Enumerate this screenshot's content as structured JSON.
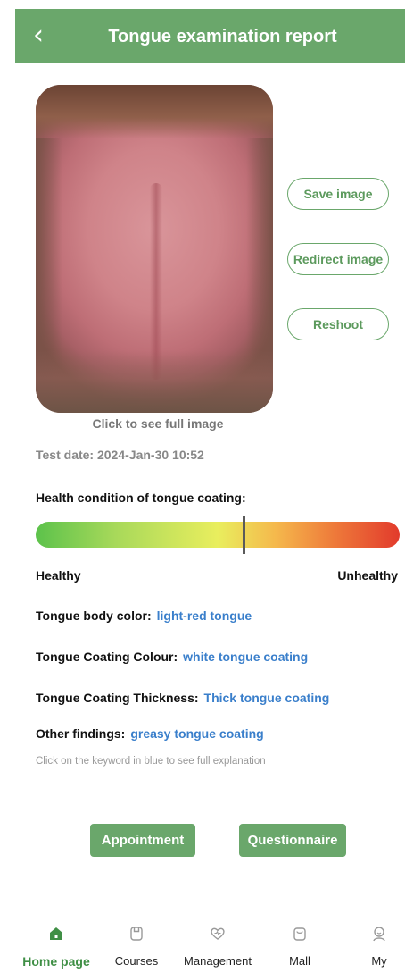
{
  "header": {
    "title": "Tongue examination report",
    "back_icon": "chevron-left-icon"
  },
  "photo": {
    "caption": "Click to see full image"
  },
  "actions_side": {
    "save": "Save image",
    "redirect": "Redirect image",
    "reshoot": "Reshoot"
  },
  "test_date": "Test date: 2024-Jan-30 10:52",
  "coating_health": {
    "label": "Health condition of tongue coating:",
    "scale_min_label": "Healthy",
    "scale_max_label": "Unhealthy",
    "level": 0.57,
    "gradient_colors": [
      "#5cc24b",
      "#e9ee5e",
      "#e23b2c"
    ]
  },
  "findings": [
    {
      "label": "Tongue body color:",
      "value": "light-red tongue"
    },
    {
      "label": "Tongue Coating Colour:",
      "value": "white tongue coating"
    },
    {
      "label": "Tongue Coating Thickness:",
      "value": "Thick tongue coating"
    },
    {
      "label": "Other findings:",
      "value": "greasy tongue coating"
    }
  ],
  "hint": "Click on the keyword in blue to see full explanation",
  "buttons": {
    "appointment": "Appointment",
    "questionnaire": "Questionnaire"
  },
  "tabbar": [
    {
      "label": "Home page",
      "icon": "home-icon",
      "active": true
    },
    {
      "label": "Courses",
      "icon": "book-icon",
      "active": false
    },
    {
      "label": "Management",
      "icon": "heart-icon",
      "active": false
    },
    {
      "label": "Mall",
      "icon": "shopping-bag-icon",
      "active": false
    },
    {
      "label": "My",
      "icon": "user-icon",
      "active": false
    }
  ],
  "colors": {
    "accent": "#6aa76b",
    "keyword": "#3a7fcb",
    "active_tab": "#3f8f45"
  }
}
